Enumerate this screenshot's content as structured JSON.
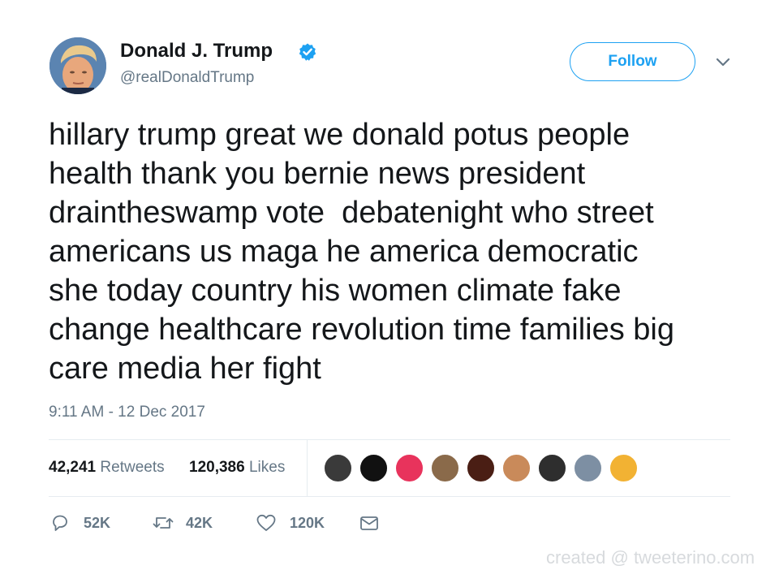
{
  "user": {
    "display_name": "Donald J. Trump",
    "handle": "@realDonaldTrump",
    "verified": true,
    "avatar_icon": "profile-photo"
  },
  "header": {
    "follow_label": "Follow",
    "menu_icon": "chevron-down-icon"
  },
  "tweet": {
    "text": "hillary trump great we donald potus people\nhealth thank you bernie news president\ndraintheswamp vote  debatenight who street\namericans us maga he america democratic\nshe today country his women climate fake\nchange healthcare revolution time families big\ncare media her fight",
    "timestamp": "9:11 AM - 12 Dec 2017"
  },
  "stats": {
    "retweets_count": "42,241",
    "retweets_label": "Retweets",
    "likes_count": "120,386",
    "likes_label": "Likes"
  },
  "likers": [
    {
      "name": "liker-avatar-1",
      "color": "#3a3a3a"
    },
    {
      "name": "liker-avatar-2",
      "color": "#111111"
    },
    {
      "name": "liker-avatar-3",
      "color": "#e8335c"
    },
    {
      "name": "liker-avatar-4",
      "color": "#8a6a4a"
    },
    {
      "name": "liker-avatar-5",
      "color": "#4a1e14"
    },
    {
      "name": "liker-avatar-6",
      "color": "#c98a5a"
    },
    {
      "name": "liker-avatar-7",
      "color": "#2e2e2e"
    },
    {
      "name": "liker-avatar-8",
      "color": "#7d8fa3"
    },
    {
      "name": "liker-avatar-9",
      "color": "#f2b233"
    }
  ],
  "actions": {
    "reply_count": "52K",
    "retweet_count": "42K",
    "like_count": "120K",
    "icons": [
      "reply-icon",
      "retweet-icon",
      "like-icon",
      "message-icon"
    ]
  },
  "footer": {
    "credit": "created @ tweeterino.com"
  },
  "colors": {
    "accent": "#1da1f2",
    "text": "#14171a",
    "secondary": "#657786",
    "divider": "#e6ecf0"
  }
}
